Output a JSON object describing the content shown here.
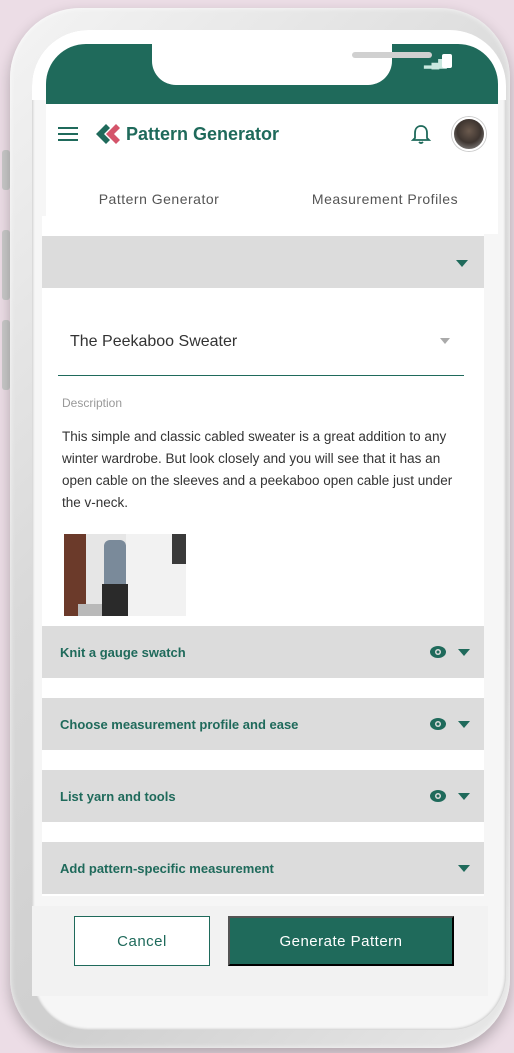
{
  "app": {
    "title": "Pattern Generator"
  },
  "tabs": [
    {
      "label": "Pattern Generator",
      "active": true
    },
    {
      "label": "Measurement Profiles",
      "active": false
    }
  ],
  "pattern": {
    "selected": "The Peekaboo Sweater",
    "description_label": "Description",
    "description": "This simple and classic cabled sweater is a great addition to any winter wardrobe. But look closely and you will see that it has an open cable on the sleeves and a peekaboo open cable just under the v-neck."
  },
  "sections": [
    {
      "title": "Knit a gauge swatch",
      "has_eye": true
    },
    {
      "title": "Choose measurement profile and ease",
      "has_eye": true
    },
    {
      "title": "List yarn and tools",
      "has_eye": true
    },
    {
      "title": "Add pattern-specific measurement",
      "has_eye": false
    }
  ],
  "actions": {
    "cancel": "Cancel",
    "generate": "Generate Pattern"
  },
  "colors": {
    "brand": "#1f6a5b",
    "section_bg": "#dcdcdc",
    "background": "#ecdde6"
  },
  "icons": {
    "menu": "hamburger-icon",
    "logo": "logo-icon",
    "notifications": "bell-icon",
    "visibility": "eye-icon",
    "expand": "caret-down-icon"
  }
}
